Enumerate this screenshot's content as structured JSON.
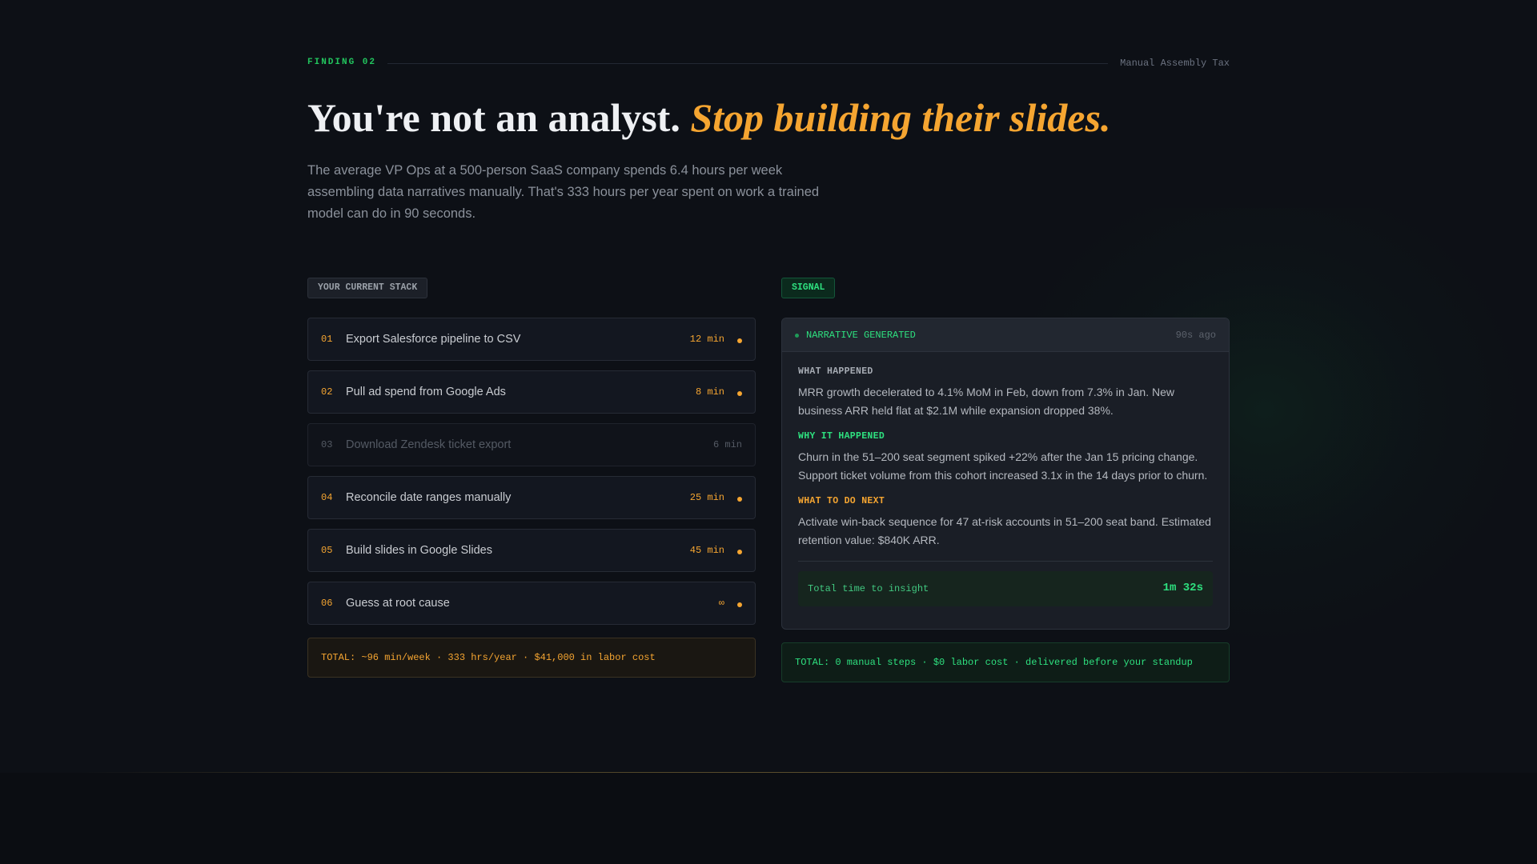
{
  "header": {
    "eyebrow": "FINDING 02",
    "right_label": "Manual Assembly Tax"
  },
  "headline": {
    "plain": "You're not an analyst. ",
    "accent": "Stop building their slides."
  },
  "lede": "The average VP Ops at a 500-person SaaS company spends 6.4 hours per week assembling data narratives manually. That's 333 hours per year spent on work a trained model can do in 90 seconds.",
  "stack": {
    "tag": "YOUR CURRENT STACK",
    "steps": [
      {
        "num": "01",
        "label": "Export Salesforce pipeline to CSV",
        "time": "12 min"
      },
      {
        "num": "02",
        "label": "Pull ad spend from Google Ads",
        "time": "8 min"
      },
      {
        "num": "03",
        "label": "Download Zendesk ticket export",
        "time": "6 min"
      },
      {
        "num": "04",
        "label": "Reconcile date ranges manually",
        "time": "25 min"
      },
      {
        "num": "05",
        "label": "Build slides in Google Slides",
        "time": "45 min"
      },
      {
        "num": "06",
        "label": "Guess at root cause",
        "time": "∞"
      }
    ],
    "total": "TOTAL: ~96 min/week · 333 hrs/year · $41,000 in labor cost"
  },
  "signal": {
    "tag": "SIGNAL",
    "status": "NARRATIVE GENERATED",
    "time_ago": "90s ago",
    "sections": [
      {
        "title": "WHAT HAPPENED",
        "text": "MRR growth decelerated to 4.1% MoM in Feb, down from 7.3% in Jan. New business ARR held flat at $2.1M while expansion dropped 38%."
      },
      {
        "title": "WHY IT HAPPENED",
        "text": "Churn in the 51–200 seat segment spiked +22% after the Jan 15 pricing change. Support ticket volume from this cohort increased 3.1x in the 14 days prior to churn."
      },
      {
        "title": "WHAT TO DO NEXT",
        "text": "Activate win-back sequence for 47 at-risk accounts in 51–200 seat band. Estimated retention value: $840K ARR."
      }
    ],
    "insight_label": "Total time to insight",
    "insight_value": "1m 32s",
    "total": "TOTAL: 0 manual steps · $0 labor cost · delivered before your standup"
  },
  "colors": {
    "background": "#0d1016",
    "amber": "#f5a531",
    "green": "#2ee07f"
  }
}
